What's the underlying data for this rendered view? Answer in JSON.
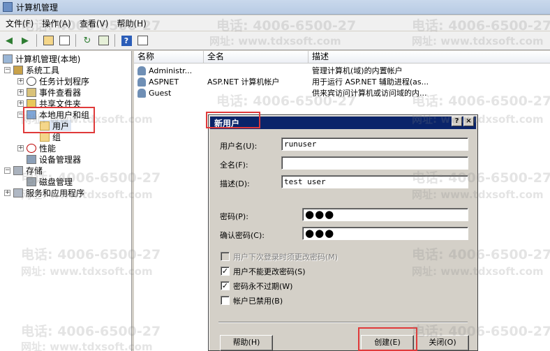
{
  "window": {
    "title": "计算机管理"
  },
  "menu": [
    "文件(F)",
    "操作(A)",
    "查看(V)",
    "帮助(H)"
  ],
  "tree": {
    "root": "计算机管理(本地)",
    "system_tools": "系统工具",
    "task_scheduler": "任务计划程序",
    "event_viewer": "事件查看器",
    "shared_folders": "共享文件夹",
    "local_users_groups": "本地用户和组",
    "users": "用户",
    "groups": "组",
    "performance": "性能",
    "device_manager": "设备管理器",
    "storage": "存储",
    "disk_management": "磁盘管理",
    "services_apps": "服务和应用程序"
  },
  "list": {
    "columns": [
      "名称",
      "全名",
      "描述"
    ],
    "rows": [
      {
        "name": "Administr...",
        "fullname": "",
        "desc": "管理计算机(域)的内置帐户"
      },
      {
        "name": "ASPNET",
        "fullname": "ASP.NET 计算机帐户",
        "desc": "用于运行 ASP.NET 辅助进程(as..."
      },
      {
        "name": "Guest",
        "fullname": "",
        "desc": "供来宾访问计算机或访问域的内..."
      }
    ]
  },
  "dialog": {
    "title": "新用户",
    "help_btn": "?",
    "close_btn": "×",
    "username_label": "用户名(U):",
    "username_value": "runuser",
    "fullname_label": "全名(F):",
    "fullname_value": "",
    "desc_label": "描述(D):",
    "desc_value": "test user",
    "password_label": "密码(P):",
    "password_value": "●●●",
    "confirm_label": "确认密码(C):",
    "confirm_value": "●●●",
    "chk_must_change": "用户下次登录时须更改密码(M)",
    "chk_cannot_change": "用户不能更改密码(S)",
    "chk_never_expires": "密码永不过期(W)",
    "chk_disabled": "帐户已禁用(B)",
    "checked_must_change": false,
    "checked_cannot_change": true,
    "checked_never_expires": true,
    "checked_disabled": false,
    "help_button": "帮助(H)",
    "create_button": "创建(E)",
    "close_button": "关闭(O)"
  },
  "watermark": {
    "phone": "电话: 4006-6500-27",
    "site": "网址: www.tdxsoft.com"
  },
  "colors": {
    "highlight": "#e03a3a",
    "dialog_title": "#0a246a"
  }
}
